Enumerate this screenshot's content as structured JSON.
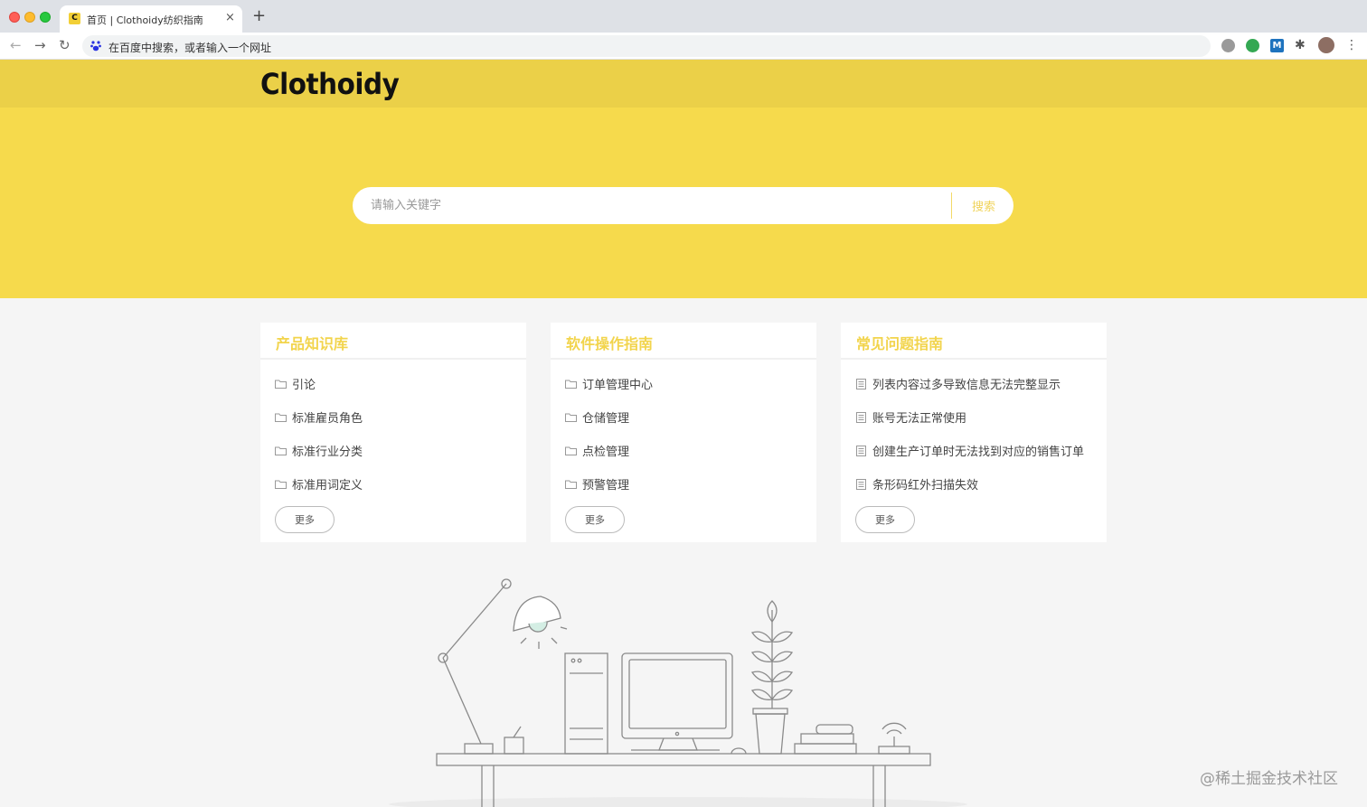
{
  "browser": {
    "tab_title": "首页 | Clothoidy纺织指南",
    "tab_favicon": "C",
    "tab_close": "×",
    "new_tab": "+",
    "nav_back": "←",
    "nav_forward": "→",
    "nav_reload": "↻",
    "address_text": "在百度中搜索，或者输入一个网址",
    "ext_m": "M",
    "puzzle": "✱",
    "menu": "⋮"
  },
  "header": {
    "logo": "Clothoidy"
  },
  "search": {
    "placeholder": "请输入关键字",
    "button": "搜索"
  },
  "cards": [
    {
      "title": "产品知识库",
      "icon": "folder-icon",
      "items": [
        "引论",
        "标准雇员角色",
        "标准行业分类",
        "标准用词定义"
      ],
      "more": "更多"
    },
    {
      "title": "软件操作指南",
      "icon": "folder-icon",
      "items": [
        "订单管理中心",
        "仓储管理",
        "点检管理",
        "预警管理"
      ],
      "more": "更多"
    },
    {
      "title": "常见问题指南",
      "icon": "document-icon",
      "items": [
        "列表内容过多导致信息无法完整显示",
        "账号无法正常使用",
        "创建生产订单时无法找到对应的销售订单",
        "条形码红外扫描失效"
      ],
      "more": "更多"
    }
  ],
  "watermark": "@稀土掘金技术社区",
  "colors": {
    "header": "#ebd048",
    "hero": "#f6da4c",
    "accent": "#f2d44c",
    "page": "#f5f5f5"
  }
}
